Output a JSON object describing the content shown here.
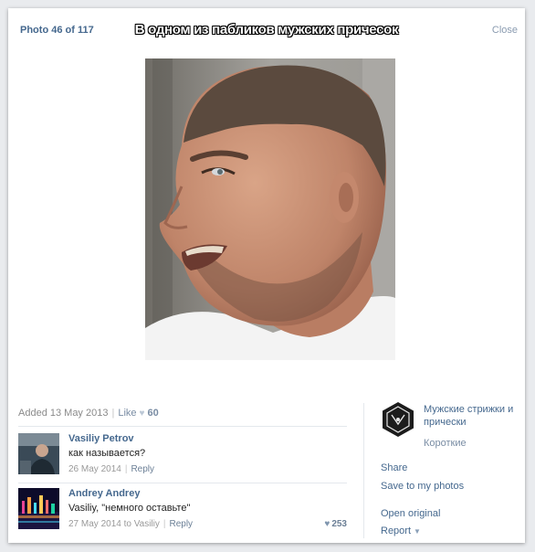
{
  "viewer": {
    "counter": "Photo 46 of 117",
    "caption": "В одном из пабликов мужских причесок",
    "close_label": "Close"
  },
  "photo": {
    "subject": "man-with-short-buzzcut-hair",
    "colors": {
      "background": "#8e8d89",
      "skin": "#c68f75",
      "shirt": "#f2f2f2",
      "hair": "#5b4a3e"
    }
  },
  "info": {
    "added": "Added 13 May 2013",
    "like_label": "Like",
    "likes_count": "60"
  },
  "comments": [
    {
      "author": "Vasiliy Petrov",
      "text": "как называется?",
      "date": "26 May 2014",
      "reply_label": "Reply",
      "likes": ""
    },
    {
      "author": "Andrey Andrey",
      "text": "Vasiliy, \"немного оставьте\"",
      "date": "27 May 2014 to Vasiliy",
      "reply_label": "Reply",
      "likes": "253"
    }
  ],
  "group": {
    "name_line1": "Мужские стрижки и",
    "name_line2": "прически",
    "album": "Короткие"
  },
  "actions": {
    "share": "Share",
    "save": "Save to my photos",
    "open_original": "Open original",
    "report": "Report"
  },
  "theme": {
    "link_color": "#45688e",
    "muted_color": "#8a8a8a",
    "heart_color": "#bcc8d6"
  }
}
